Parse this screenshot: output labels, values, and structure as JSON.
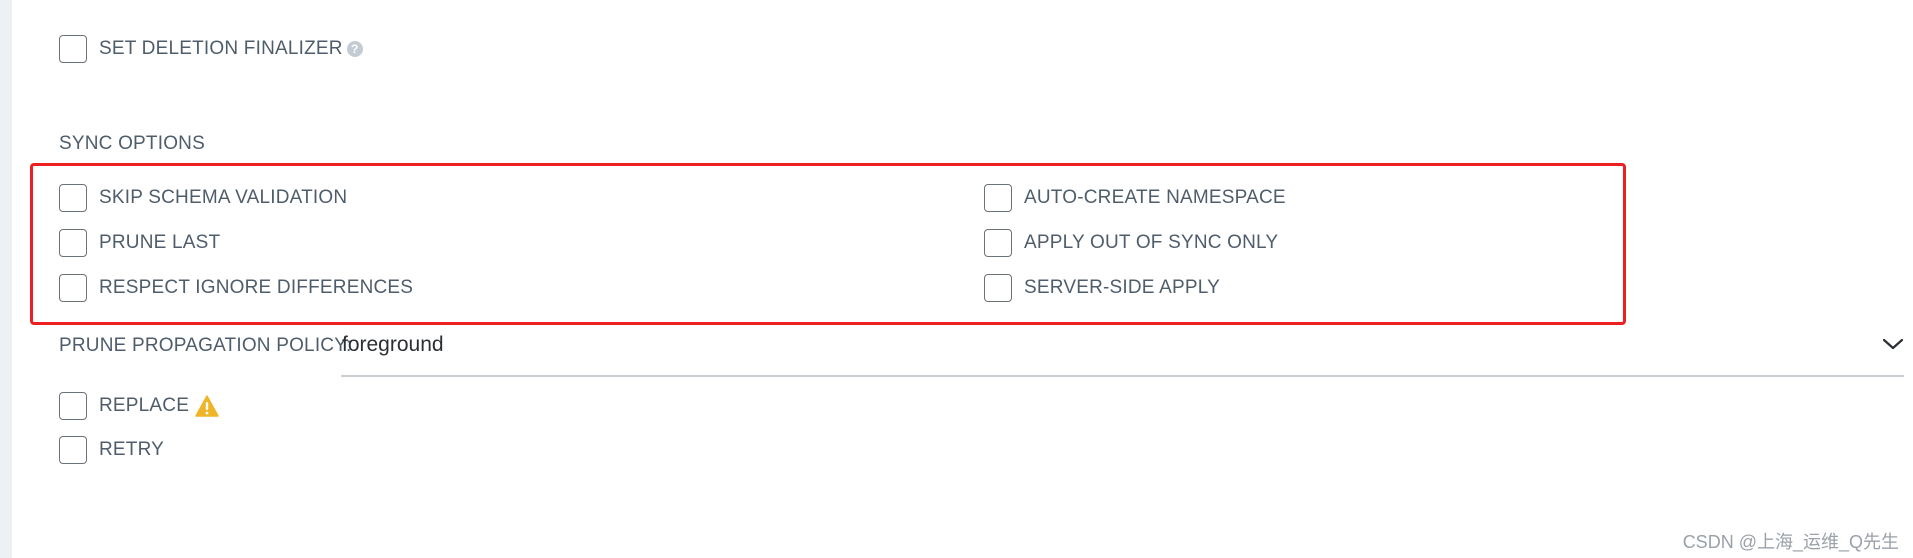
{
  "deletion": {
    "finalizer_label": "SET DELETION FINALIZER",
    "help_glyph": "?"
  },
  "sync_options": {
    "title": "SYNC OPTIONS",
    "left": [
      {
        "label": "SKIP SCHEMA VALIDATION"
      },
      {
        "label": "PRUNE LAST"
      },
      {
        "label": "RESPECT IGNORE DIFFERENCES"
      }
    ],
    "right": [
      {
        "label": "AUTO-CREATE NAMESPACE"
      },
      {
        "label": "APPLY OUT OF SYNC ONLY"
      },
      {
        "label": "SERVER-SIDE APPLY"
      }
    ]
  },
  "prune_policy": {
    "label": "PRUNE PROPAGATION POLICY:",
    "value": "foreground"
  },
  "extra_options": {
    "replace_label": "REPLACE",
    "retry_label": "RETRY"
  },
  "watermark": "CSDN @上海_运维_Q先生",
  "colors": {
    "highlight_border": "#ec2020",
    "warning": "#f0b429",
    "text": "#4f5d6b"
  },
  "icons": [
    "help-icon",
    "warning-icon",
    "chevron-down-icon"
  ]
}
